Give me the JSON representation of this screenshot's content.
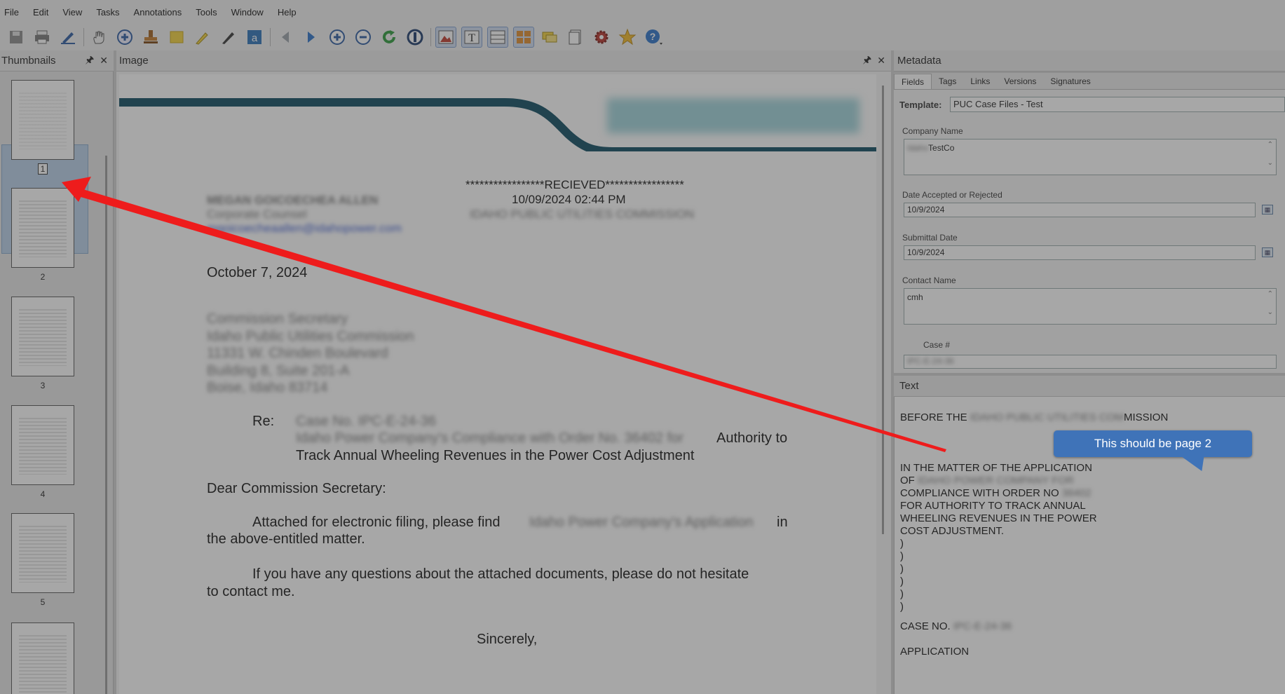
{
  "menu": [
    "File",
    "Edit",
    "View",
    "Tasks",
    "Annotations",
    "Tools",
    "Window",
    "Help"
  ],
  "toolbar": {
    "icons": [
      "save-icon",
      "print-icon",
      "edit-pen-icon",
      "hand-icon",
      "zoom-add-icon",
      "stamp-icon",
      "sticky-note-icon",
      "highlighter-icon",
      "pen-icon",
      "text-a-icon",
      "back-icon",
      "forward-icon",
      "zoom-in-icon",
      "zoom-out-icon",
      "refresh-icon",
      "ocr-icon",
      "image-view-icon",
      "text-view-icon",
      "split-view-icon",
      "grid-view-icon",
      "comments-icon",
      "page-icon",
      "settings-gear-icon",
      "favorite-star-icon",
      "help-icon"
    ]
  },
  "thumbnails": {
    "title": "Thumbnails",
    "pin": "🖈",
    "close": "✕",
    "pages": [
      "1",
      "2",
      "3",
      "4",
      "5"
    ]
  },
  "image_panel": {
    "title": "Image",
    "pin": "🖈",
    "close": "✕",
    "received_stamp": "*****************RECIEVED*****************",
    "received_date": "10/09/2024 02:44 PM",
    "received_by": "IDAHO PUBLIC UTILITIES COMMISSION",
    "sender_name": "MEGAN GOICOECHEA ALLEN",
    "sender_title": "Corporate Counsel",
    "sender_email": "mgoicoecheaallen@idahopower.com",
    "date": "October 7, 2024",
    "address": [
      "Commission Secretary",
      "Idaho Public Utilities Commission",
      "11331 W. Chinden Boulevard",
      "Building 8, Suite 201-A",
      "Boise, Idaho  83714"
    ],
    "re_label": "Re:",
    "re_case": "Case No. IPC-E-24-36",
    "re_line1_blur": "Idaho Power Company's Compliance with Order No. 36402 for",
    "re_line1_visible": "Authority to",
    "re_line2": "Track Annual Wheeling Revenues in the Power Cost Adjustment",
    "salutation": "Dear Commission Secretary:",
    "para1_start": "Attached for electronic filing, please find",
    "para1_blur": "Idaho Power Company's Application",
    "para1_end": "in",
    "para1_line2": "the above-entitled matter.",
    "para2_line1": "If you have any questions about the attached documents, please do not hesitate",
    "para2_line2": "to contact me.",
    "closing": "Sincerely,"
  },
  "metadata": {
    "title": "Metadata",
    "tabs": [
      "Fields",
      "Tags",
      "Links",
      "Versions",
      "Signatures"
    ],
    "template_label": "Template:",
    "template_value": "PUC Case Files - Test",
    "company_label": "Company Name",
    "company_blur": "Idaho",
    "company_value": "TestCo",
    "date_accepted_label": "Date Accepted or Rejected",
    "date_accepted_value": "10/9/2024",
    "submittal_label": "Submittal Date",
    "submittal_value": "10/9/2024",
    "contact_label": "Contact Name",
    "contact_value": "cmh",
    "case_label": "Case #",
    "case_blur": "IPC-E-24-36",
    "spin_up": "⌃",
    "spin_down": "⌄",
    "cal": "▦"
  },
  "text_panel": {
    "title": "Text",
    "line_before": "BEFORE THE",
    "line_before_blur": "IDAHO PUBLIC UTILITIES COM",
    "line_before_end": "MISSION",
    "line_matter": "IN THE MATTER OF THE APPLICATION",
    "line_of": "OF",
    "line_of_blur": "IDAHO POWER COMPANY FOR",
    "line_compliance": "COMPLIANCE WITH ORDER NO",
    "line_compliance_blur": "36402",
    "line_authority": "FOR AUTHORITY TO TRACK ANNUAL",
    "line_wheeling": "WHEELING REVENUES IN THE POWER",
    "line_cost": "COST ADJUSTMENT.",
    "parens": [
      ")",
      ")",
      ")",
      ")",
      ")",
      ")"
    ],
    "case_no": "CASE NO.",
    "case_no_blur": "IPC-E-24-36",
    "application": "APPLICATION"
  },
  "annotation": {
    "callout": "This should be page 2",
    "arrow_color": "#ee1c1c",
    "callout_color": "#3f73b8"
  }
}
